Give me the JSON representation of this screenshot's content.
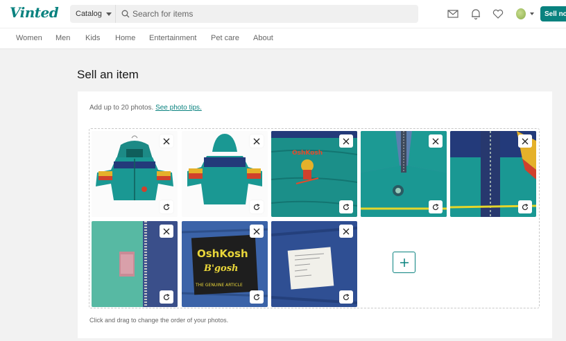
{
  "header": {
    "logo": "Vinted",
    "catalog_label": "Catalog",
    "search_placeholder": "Search for items",
    "icons": [
      "mail-icon",
      "bell-icon",
      "heart-icon",
      "user-avatar"
    ],
    "sell_label": "Sell now",
    "brand_color": "#09827f"
  },
  "categories": [
    "Women",
    "Men",
    "Kids",
    "Home",
    "Entertainment",
    "Pet care",
    "About"
  ],
  "page": {
    "title": "Sell an item",
    "hint": "Add up to 20 photos.",
    "hint_link": "See photo tips.",
    "footnote": "Click and drag to change the order of your photos."
  },
  "photos": [
    {
      "name": "photo-jacket-front"
    },
    {
      "name": "photo-jacket-back"
    },
    {
      "name": "photo-jacket-patch"
    },
    {
      "name": "photo-jacket-collar"
    },
    {
      "name": "photo-jacket-zipper"
    },
    {
      "name": "photo-jacket-zipper-detail"
    },
    {
      "name": "photo-oshkosh-label",
      "label_text": [
        "OshKosh",
        "B'gosh",
        "THE GENUINE ARTICLE"
      ]
    },
    {
      "name": "photo-care-label"
    }
  ]
}
